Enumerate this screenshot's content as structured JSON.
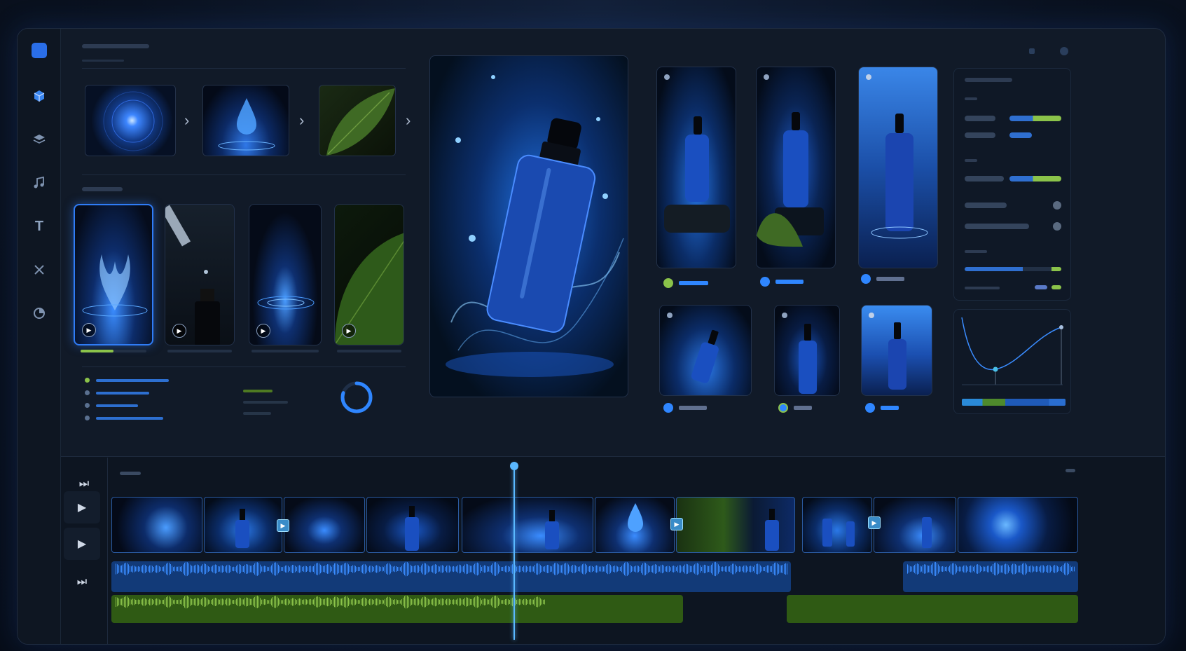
{
  "app": {
    "accent": "#2f7cf6",
    "green": "#8bc34a",
    "bg": "#111a28"
  },
  "sidebar": {
    "icons": [
      "logo-icon",
      "cube-icon",
      "layers-icon",
      "music-icon",
      "text-icon",
      "scissors-icon",
      "color-wheel-icon"
    ],
    "text_icon_glyph": "T"
  },
  "playback": {
    "play_glyph": "▶",
    "skip_glyph": "⏭"
  },
  "circular_progress": {
    "value": 0.8
  },
  "graph": {
    "type": "curve"
  },
  "timeline": {
    "playhead": 0.41
  }
}
